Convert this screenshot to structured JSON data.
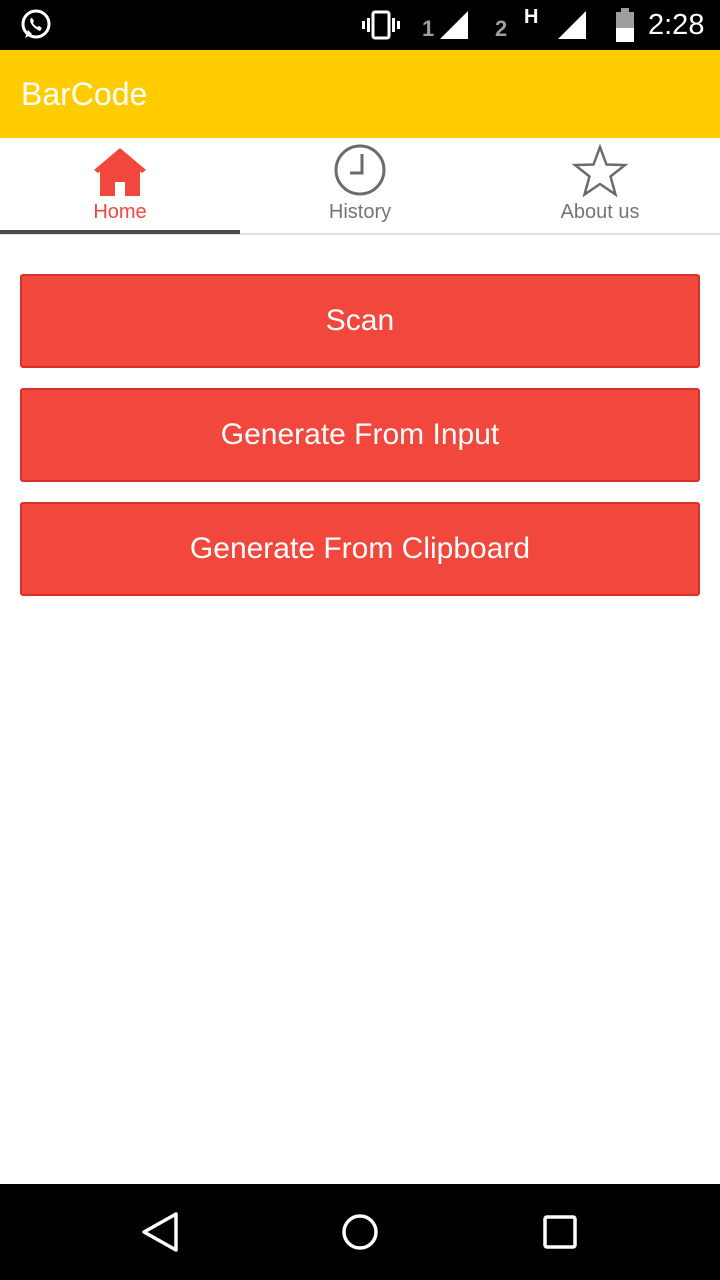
{
  "status_bar": {
    "time": "2:28",
    "sim1_label": "1",
    "sim2_label": "2",
    "network_type": "H",
    "icons": [
      "whatsapp-icon",
      "vibrate-icon",
      "signal-icon",
      "battery-icon"
    ]
  },
  "app_bar": {
    "title": "BarCode",
    "color": "#ffcc00"
  },
  "tabs": [
    {
      "label": "Home",
      "icon": "home-icon",
      "active": true
    },
    {
      "label": "History",
      "icon": "clock-icon",
      "active": false
    },
    {
      "label": "About us",
      "icon": "star-icon",
      "active": false
    }
  ],
  "actions": {
    "scan_label": "Scan",
    "generate_input_label": "Generate From Input",
    "generate_clipboard_label": "Generate From Clipboard",
    "button_color": "#f2473c"
  },
  "nav_bar": {
    "icons": [
      "back-icon",
      "home-circle-icon",
      "recents-icon"
    ]
  }
}
